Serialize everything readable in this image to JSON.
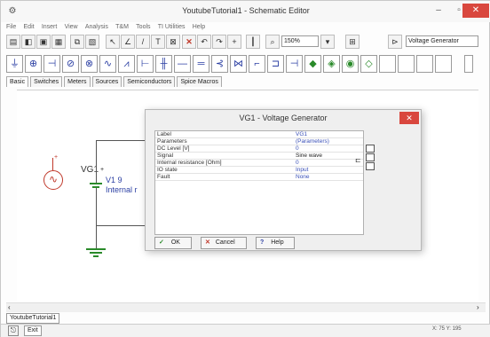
{
  "window": {
    "title": "YoutubeTutorial1 - Schematic Editor"
  },
  "menu": [
    "File",
    "Edit",
    "Insert",
    "View",
    "Analysis",
    "T&M",
    "Tools",
    "TI Utilities",
    "Help"
  ],
  "toolbar": {
    "zoom_value": "150%",
    "component_select": "Voltage Generator"
  },
  "tabs": [
    "Basic",
    "Switches",
    "Meters",
    "Sources",
    "Semiconductors",
    "Spice Macros"
  ],
  "schematic": {
    "generator_label": "VG1",
    "battery_label": "V1 9",
    "battery_sublabel": "Internal r"
  },
  "dialog": {
    "title": "VG1 - Voltage Generator",
    "close": "✕",
    "properties": [
      {
        "key": "Label",
        "value": "VG1"
      },
      {
        "key": "Parameters",
        "value": "(Parameters)"
      },
      {
        "key": "DC Level [V]",
        "value": "0"
      },
      {
        "key": "Signal",
        "value": "Sine wave"
      },
      {
        "key": "Internal resistance [Ohm]",
        "value": "0"
      },
      {
        "key": "IO state",
        "value": "Input"
      },
      {
        "key": "Fault",
        "value": "None"
      }
    ],
    "ok_label": "OK",
    "cancel_label": "Cancel",
    "help_label": "Help"
  },
  "document_tab": "YoutubeTutorial1",
  "status": {
    "exit_label": "Exit",
    "coords": "X: 75 Y: 195"
  }
}
